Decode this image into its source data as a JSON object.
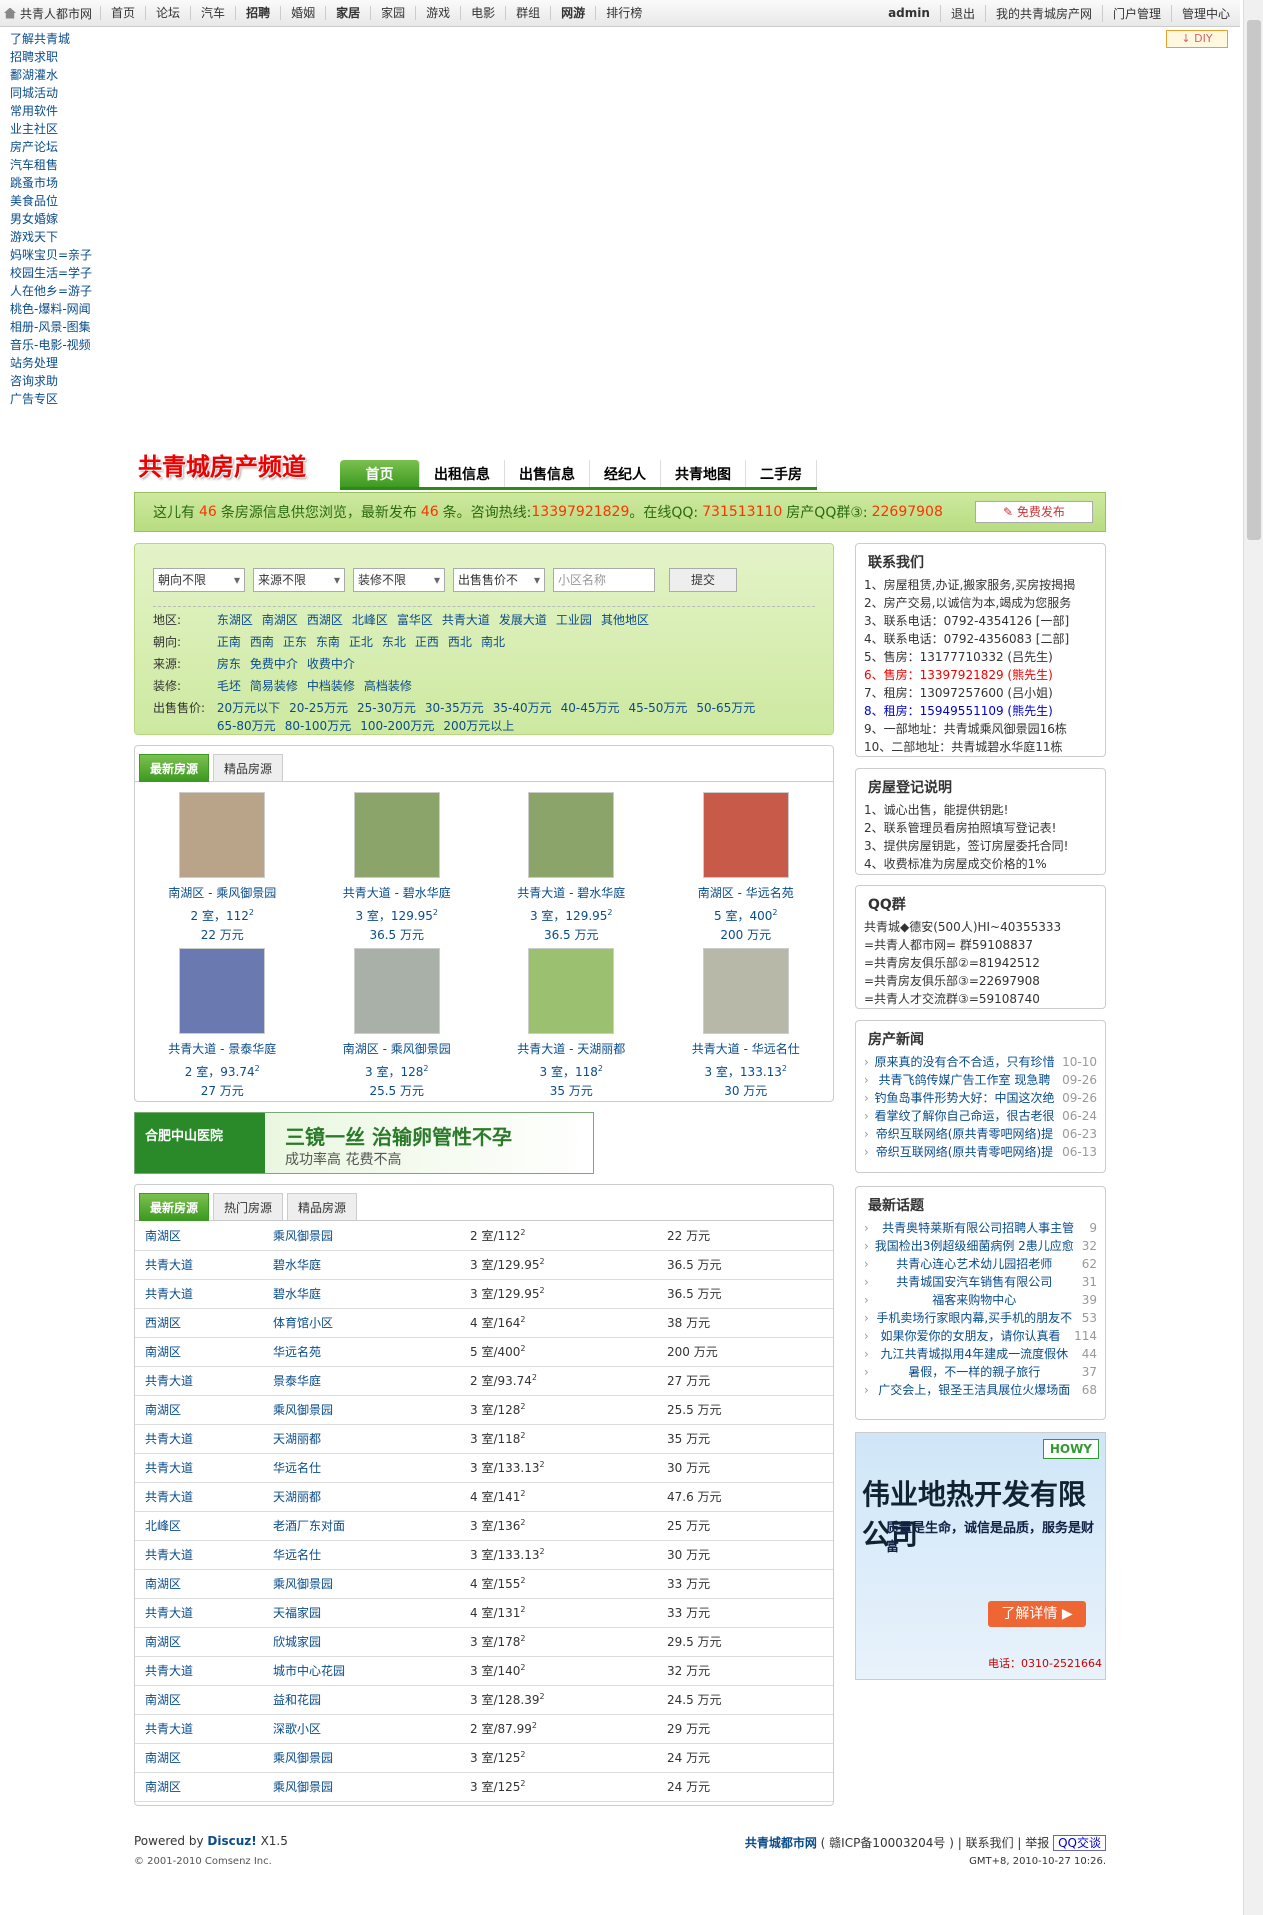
{
  "topbar": {
    "site": "共青人都市网",
    "nav": [
      "首页",
      "论坛",
      "汽车",
      "招聘",
      "婚姻",
      "家居",
      "家园",
      "游戏",
      "电影",
      "群组",
      "网游",
      "排行榜"
    ],
    "user": "admin",
    "logout": "退出",
    "my_site": "我的共青城房产网",
    "portal_admin": "门户管理",
    "admin_center": "管理中心"
  },
  "diy": "↓ DIY",
  "sidelinks": [
    "了解共青城",
    "招聘求职",
    "鄱湖灌水",
    "同城活动",
    "常用软件",
    "业主社区",
    "房产论坛",
    "汽车租售",
    "跳蚤市场",
    "美食品位",
    "男女婚嫁",
    "游戏天下",
    "妈咪宝贝=亲子",
    "校园生活=学子",
    "人在他乡=游子",
    "桃色-爆料-网闻",
    "相册-风景-图集",
    "音乐-电影-视频",
    "站务处理",
    "咨询求助",
    "广告专区"
  ],
  "banner_title": "共青城房产频道",
  "main_tabs": [
    "首页",
    "出租信息",
    "出售信息",
    "经纪人",
    "共青地图",
    "二手房"
  ],
  "infobar": {
    "t1": "这儿有",
    "n1": "46",
    "t2": "条房源信息供您浏览，最新发布",
    "n2": "46",
    "t3": "条。咨询热线:",
    "phone": "13397921829",
    "t4": "。在线QQ:",
    "qq": "731513110",
    "t5": "房产QQ群③:",
    "group": "22697908",
    "btn": "免费发布"
  },
  "filter": {
    "selects": [
      "朝向不限",
      "来源不限",
      "装修不限",
      "出售售价不"
    ],
    "placeholder": "小区名称",
    "submit": "提交",
    "rows": [
      {
        "label": "地区:",
        "opts": [
          "东湖区",
          "南湖区",
          "西湖区",
          "北峰区",
          "富华区",
          "共青大道",
          "发展大道",
          "工业园",
          "其他地区"
        ]
      },
      {
        "label": "朝向:",
        "opts": [
          "正南",
          "西南",
          "正东",
          "东南",
          "正北",
          "东北",
          "正西",
          "西北",
          "南北"
        ]
      },
      {
        "label": "来源:",
        "opts": [
          "房东",
          "免费中介",
          "收费中介"
        ]
      },
      {
        "label": "装修:",
        "opts": [
          "毛坯",
          "简易装修",
          "中档装修",
          "高档装修"
        ]
      },
      {
        "label": "出售售价:",
        "opts": [
          "20万元以下",
          "20-25万元",
          "25-30万元",
          "30-35万元",
          "35-40万元",
          "40-45万元",
          "45-50万元",
          "50-65万元",
          "65-80万元",
          "80-100万元",
          "100-200万元",
          "200万元以上"
        ]
      }
    ]
  },
  "featured": {
    "tabs": [
      "最新房源",
      "精品房源"
    ],
    "cards": [
      {
        "title": "南湖区 - 乘风御景园",
        "rooms": "2 室，112",
        "price": "22 万元",
        "color": "#b9a48a"
      },
      {
        "title": "共青大道 - 碧水华庭",
        "rooms": "3 室，129.95",
        "price": "36.5 万元",
        "color": "#8aa46a"
      },
      {
        "title": "共青大道 - 碧水华庭",
        "rooms": "3 室，129.95",
        "price": "36.5 万元",
        "color": "#8aa46a"
      },
      {
        "title": "南湖区 - 华远名苑",
        "rooms": "5 室，400",
        "price": "200 万元",
        "color": "#c85a4a"
      },
      {
        "title": "共青大道 - 景泰华庭",
        "rooms": "2 室，93.74",
        "price": "27 万元",
        "color": "#6a7ab0"
      },
      {
        "title": "南湖区 - 乘风御景园",
        "rooms": "3 室，128",
        "price": "25.5 万元",
        "color": "#a8b0a8"
      },
      {
        "title": "共青大道 - 天湖丽都",
        "rooms": "3 室，118",
        "price": "35 万元",
        "color": "#9ac070"
      },
      {
        "title": "共青大道 - 华远名仕",
        "rooms": "3 室，133.13",
        "price": "30 万元",
        "color": "#b8b8a8"
      }
    ]
  },
  "ad_banner": {
    "l1": "合肥中山医院",
    "l2": "三镜一丝 治输卵管性不孕",
    "l3": "成功率高 花费不高"
  },
  "list": {
    "tabs": [
      "最新房源",
      "热门房源",
      "精品房源"
    ],
    "rows": [
      [
        "南湖区",
        "乘风御景园",
        "2 室/112",
        "22 万元"
      ],
      [
        "共青大道",
        "碧水华庭",
        "3 室/129.95",
        "36.5 万元"
      ],
      [
        "共青大道",
        "碧水华庭",
        "3 室/129.95",
        "36.5 万元"
      ],
      [
        "西湖区",
        "体育馆小区",
        "4 室/164",
        "38 万元"
      ],
      [
        "南湖区",
        "华远名苑",
        "5 室/400",
        "200 万元"
      ],
      [
        "共青大道",
        "景泰华庭",
        "2 室/93.74",
        "27 万元"
      ],
      [
        "南湖区",
        "乘风御景园",
        "3 室/128",
        "25.5 万元"
      ],
      [
        "共青大道",
        "天湖丽都",
        "3 室/118",
        "35 万元"
      ],
      [
        "共青大道",
        "华远名仕",
        "3 室/133.13",
        "30 万元"
      ],
      [
        "共青大道",
        "天湖丽都",
        "4 室/141",
        "47.6 万元"
      ],
      [
        "北峰区",
        "老酒厂东对面",
        "3 室/136",
        "25 万元"
      ],
      [
        "共青大道",
        "华远名仕",
        "3 室/133.13",
        "30 万元"
      ],
      [
        "南湖区",
        "乘风御景园",
        "4 室/155",
        "33 万元"
      ],
      [
        "共青大道",
        "天福家园",
        "4 室/131",
        "33 万元"
      ],
      [
        "南湖区",
        "欣城家园",
        "3 室/178",
        "29.5 万元"
      ],
      [
        "共青大道",
        "城市中心花园",
        "3 室/140",
        "32 万元"
      ],
      [
        "南湖区",
        "益和花园",
        "3 室/128.39",
        "24.5 万元"
      ],
      [
        "共青大道",
        "深歌小区",
        "2 室/87.99",
        "29 万元"
      ],
      [
        "南湖区",
        "乘风御景园",
        "3 室/125",
        "24 万元"
      ],
      [
        "南湖区",
        "乘风御景园",
        "3 室/125",
        "24 万元"
      ]
    ]
  },
  "contact": {
    "title": "联系我们",
    "lines": [
      "1、房屋租赁,办证,搬家服务,买房按揭揭",
      "2、房产交易,以诚信为本,竭成为您服务",
      "3、联系电话：0792-4354126 [一部]",
      "4、联系电话：0792-4356083 [二部]",
      "5、售房：13177710332 (吕先生)",
      "6、售房：13397921829 (熊先生)",
      "7、租房：13097257600 (吕小姐)",
      "8、租房：15949551109 (熊先生)",
      "9、一部地址：共青城乘风御景园16栋",
      "10、二部地址：共青城碧水华庭11栋"
    ]
  },
  "reg": {
    "title": "房屋登记说明",
    "lines": [
      "1、诚心出售，能提供钥匙!",
      "2、联系管理员看房拍照填写登记表!",
      "3、提供房屋钥匙，签订房屋委托合同!",
      "4、收费标准为房屋成交价格的1%"
    ]
  },
  "qq": {
    "title": "QQ群",
    "lines": [
      "共青城◆德安(500人)HI~40355333",
      "=共青人都市网= 群59108837",
      "=共青房友俱乐部②=81942512",
      "=共青房友俱乐部③=22697908",
      "=共青人才交流群③=59108740"
    ]
  },
  "news": {
    "title": "房产新闻",
    "items": [
      [
        "原来真的没有合不合适，只有珍惜",
        "10-10"
      ],
      [
        "共青飞鸽传媒广告工作室 现急聘",
        "09-26"
      ],
      [
        "钓鱼岛事件形势大好：中国这次绝",
        "09-26"
      ],
      [
        "看掌纹了解你自己命运，很古老很",
        "06-24"
      ],
      [
        "帝织互联网络(原共青零吧网络)提",
        "06-23"
      ],
      [
        "帝织互联网络(原共青零吧网络)提",
        "06-13"
      ]
    ]
  },
  "topics": {
    "title": "最新话题",
    "items": [
      [
        "共青奥特莱斯有限公司招聘人事主管",
        "9"
      ],
      [
        "我国检出3例超级细菌病例 2患儿应愈",
        "32"
      ],
      [
        "共青心连心艺术幼儿园招老师",
        "62"
      ],
      [
        "共青城国安汽车销售有限公司",
        "31"
      ],
      [
        "福客来购物中心",
        "39"
      ],
      [
        "手机卖场行家眼内幕,买手机的朋友不",
        "53"
      ],
      [
        "如果你爱你的女朋友，请你认真看",
        "114"
      ],
      [
        "九江共青城拟用4年建成一流度假休",
        "44"
      ],
      [
        "暑假，不一样的親子旅行",
        "37"
      ],
      [
        "广交会上，银圣王洁具展位火爆场面",
        "68"
      ]
    ]
  },
  "ad_right": {
    "logo": "HOWY",
    "title": "伟业地热开发有限公司",
    "slogan": "质量是生命，诚信是品质，服务是财富",
    "button": "了解详情",
    "phone": "电话：0310-2521664"
  },
  "footer": {
    "powered": "Powered by",
    "discuz": "Discuz!",
    "ver": "X1.5",
    "copy": "© 2001-2010 Comsenz Inc.",
    "site": "共青城都市网",
    "icp": "( 赣ICP备10003204号 )",
    "contact": "联系我们",
    "report": "举报",
    "qq": "QQ交谈",
    "time": "GMT+8, 2010-10-27 10:26."
  }
}
